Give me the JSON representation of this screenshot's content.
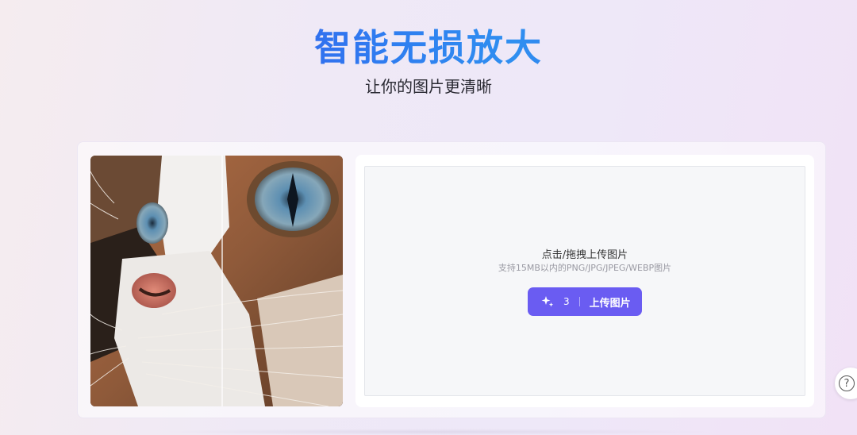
{
  "hero": {
    "title": "智能无损放大",
    "subtitle": "让你的图片更清晰"
  },
  "preview": {
    "image_description_icon": "cat-closeup-compare-icon",
    "divider_icon": "compare-divider-icon"
  },
  "upload": {
    "title": "点击/拖拽上传图片",
    "hint": "支持15MB以内的PNG/JPG/JPEG/WEBP图片",
    "button_icon": "sparkle-icon",
    "credits": "3",
    "button_label": "上传图片"
  },
  "help": {
    "icon": "question-icon",
    "glyph": "?"
  },
  "colors": {
    "accent": "#6a5cf2",
    "title_gradient_start": "#3b3de8",
    "title_gradient_mid": "#2f8ff0"
  }
}
